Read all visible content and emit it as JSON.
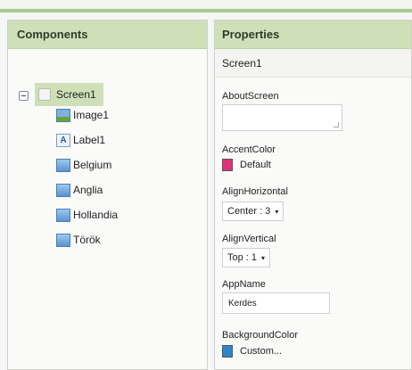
{
  "components": {
    "header": "Components",
    "root": {
      "label": "Screen1"
    },
    "children": [
      {
        "label": "Image1",
        "icon": "image-icon"
      },
      {
        "label": "Label1",
        "icon": "label-icon",
        "glyph": "A"
      },
      {
        "label": "Belgium",
        "icon": "button-icon"
      },
      {
        "label": "Anglia",
        "icon": "button-icon"
      },
      {
        "label": "Hollandia",
        "icon": "button-icon"
      },
      {
        "label": "Török",
        "icon": "button-icon"
      }
    ]
  },
  "properties": {
    "header": "Properties",
    "selected": "Screen1",
    "about_screen": {
      "label": "AboutScreen",
      "value": ""
    },
    "accent_color": {
      "label": "AccentColor",
      "value": "Default",
      "color": "#e0337a"
    },
    "align_horizontal": {
      "label": "AlignHorizontal",
      "value": "Center : 3"
    },
    "align_vertical": {
      "label": "AlignVertical",
      "value": "Top : 1"
    },
    "app_name": {
      "label": "AppName",
      "value": "Kerdes"
    },
    "background_color": {
      "label": "BackgroundColor",
      "value": "Custom...",
      "color": "#2e86c9"
    },
    "chevron": "▾"
  },
  "theme": {
    "header_green": "#cfe0b9",
    "accent_strip": "#a7cc8f"
  }
}
